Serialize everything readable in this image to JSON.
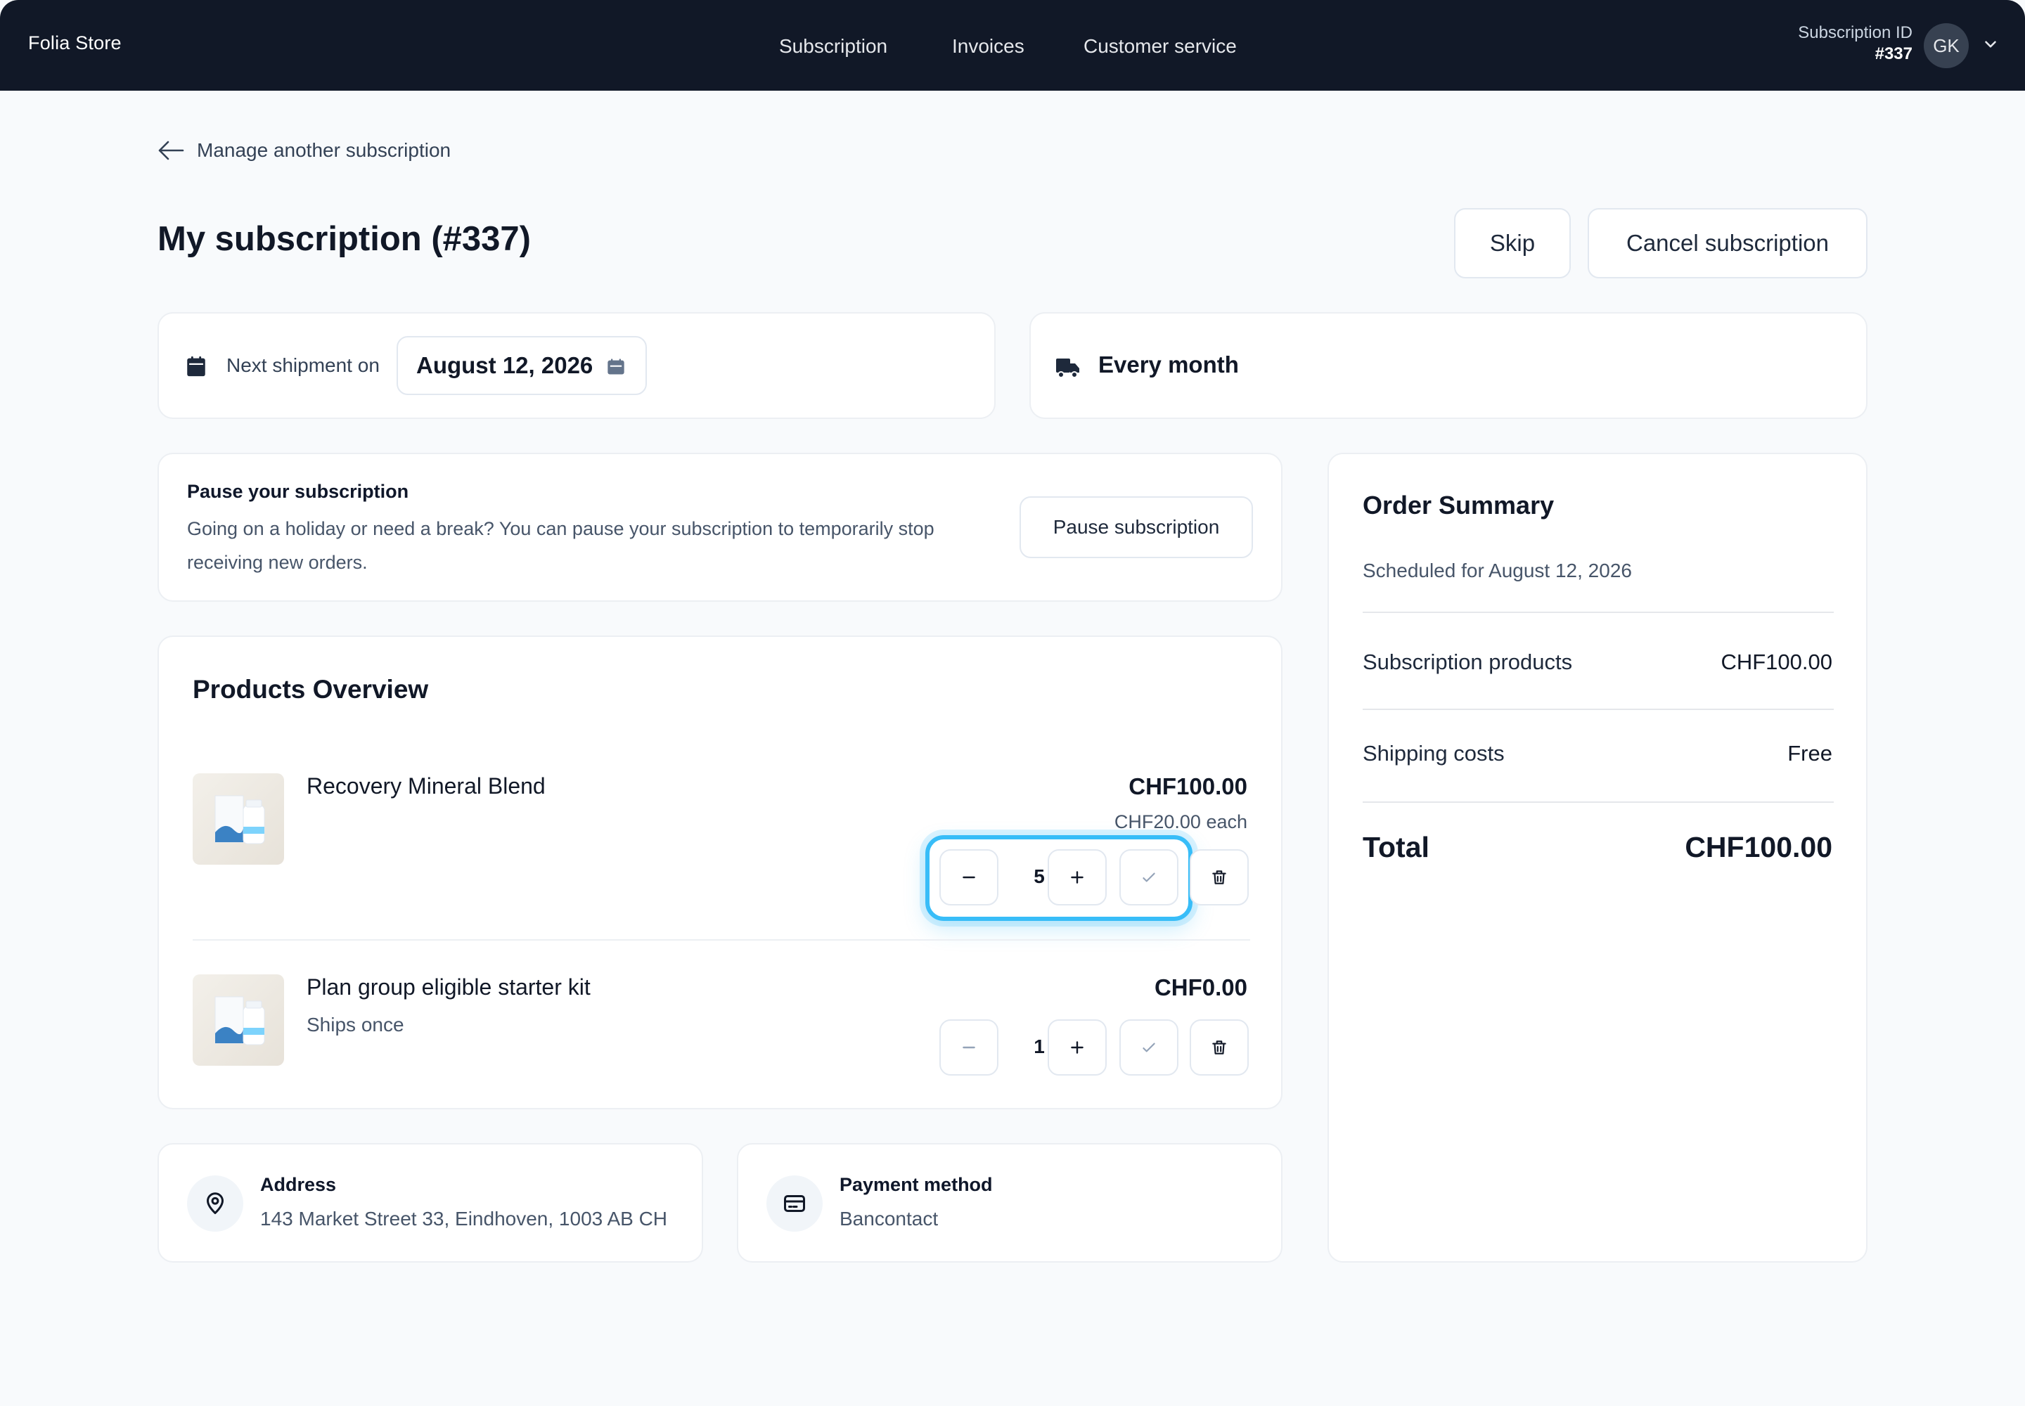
{
  "header": {
    "brand": "Folia Store",
    "nav": [
      "Subscription",
      "Invoices",
      "Customer service"
    ],
    "subscription_id_label": "Subscription ID",
    "subscription_id_value": "#337",
    "avatar_initials": "GK"
  },
  "back_link": "Manage another subscription",
  "page_title": "My subscription (#337)",
  "actions": {
    "skip": "Skip",
    "cancel": "Cancel subscription"
  },
  "shipment": {
    "label": "Next shipment on",
    "date": "August 12, 2026"
  },
  "frequency": "Every month",
  "pause": {
    "title": "Pause your subscription",
    "description": "Going on a holiday or need a break? You can pause your subscription to temporarily stop receiving new orders.",
    "button": "Pause subscription"
  },
  "products": {
    "title": "Products Overview",
    "items": [
      {
        "name": "Recovery Mineral Blend",
        "subtitle": "",
        "price": "CHF100.00",
        "each": "CHF20.00 each",
        "quantity": "5"
      },
      {
        "name": "Plan group eligible starter kit",
        "subtitle": "Ships once",
        "price": "CHF0.00",
        "each": "",
        "quantity": "1"
      }
    ]
  },
  "summary": {
    "title": "Order Summary",
    "scheduled": "Scheduled for August 12, 2026",
    "rows": [
      {
        "label": "Subscription products",
        "value": "CHF100.00"
      },
      {
        "label": "Shipping costs",
        "value": "Free"
      }
    ],
    "total_label": "Total",
    "total_value": "CHF100.00"
  },
  "address": {
    "title": "Address",
    "value": "143 Market Street 33, Eindhoven, 1003 AB CH"
  },
  "payment": {
    "title": "Payment method",
    "value": "Bancontact"
  },
  "colors": {
    "nav_bg": "#111827",
    "page_bg": "#f8fafc",
    "focus_ring": "#38bdf8"
  },
  "icons": [
    "arrow-left-icon",
    "calendar-icon",
    "truck-icon",
    "minus-icon",
    "plus-icon",
    "check-icon",
    "trash-icon",
    "map-pin-icon",
    "credit-card-icon",
    "chevron-down-icon"
  ]
}
